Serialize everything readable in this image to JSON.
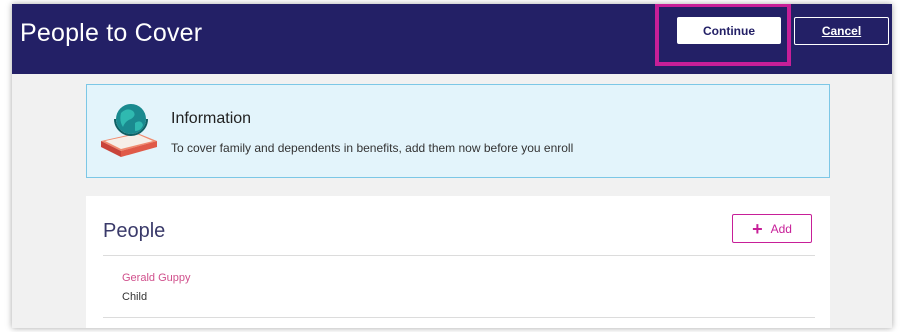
{
  "header": {
    "title": "People to Cover",
    "continue_label": "Continue",
    "cancel_label": "Cancel"
  },
  "info": {
    "title": "Information",
    "text": "To cover family and dependents in benefits, add them now before you enroll",
    "icon": "book-globe-icon"
  },
  "people": {
    "title": "People",
    "add_label": "Add",
    "items": [
      {
        "name": "Gerald Guppy",
        "role": "Child"
      }
    ]
  },
  "colors": {
    "header_bg": "#232066",
    "accent": "#c71f98",
    "info_bg": "#e3f4fb",
    "info_border": "#7cc7e6"
  }
}
